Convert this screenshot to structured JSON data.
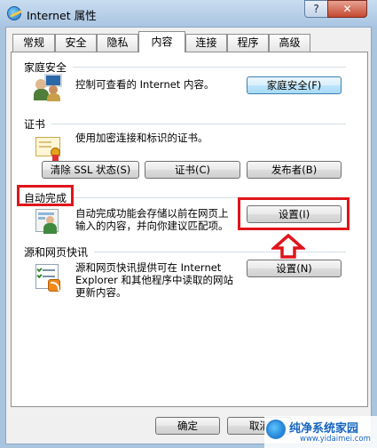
{
  "window": {
    "title": "Internet 属性",
    "help_label": "?",
    "close_label": "✕"
  },
  "tabs": [
    {
      "label": "常规"
    },
    {
      "label": "安全"
    },
    {
      "label": "隐私"
    },
    {
      "label": "内容",
      "active": true
    },
    {
      "label": "连接"
    },
    {
      "label": "程序"
    },
    {
      "label": "高级"
    }
  ],
  "family_safety": {
    "group_label": "家庭安全",
    "icon": "family-safety-icon",
    "description": "控制可查看的 Internet 内容。",
    "button_label": "家庭安全(F)"
  },
  "certificates": {
    "group_label": "证书",
    "icon": "certificate-icon",
    "description": "使用加密连接和标识的证书。",
    "buttons": [
      "清除 SSL 状态(S)",
      "证书(C)",
      "发布者(B)"
    ]
  },
  "autocomplete": {
    "group_label": "自动完成",
    "icon": "autocomplete-icon",
    "description_line1": "自动完成功能会存储以前在网页上",
    "description_line2": "输入的内容，并向你建议匹配项。",
    "button_label": "设置(I)"
  },
  "feeds": {
    "group_label": "源和网页快讯",
    "icon": "rss-feed-icon",
    "description_line1": "源和网页快讯提供可在 Internet",
    "description_line2": "Explorer 和其他程序中读取的网站",
    "description_line3": "更新内容。",
    "button_label": "设置(N)"
  },
  "footer": {
    "ok_label": "确定",
    "cancel_label": "取消"
  },
  "annotation": {
    "color": "#e0141b",
    "arrow_icon": "up-arrow-icon"
  },
  "watermark": {
    "title": "纯净系统家园",
    "url": "www.yidaimei.com"
  }
}
